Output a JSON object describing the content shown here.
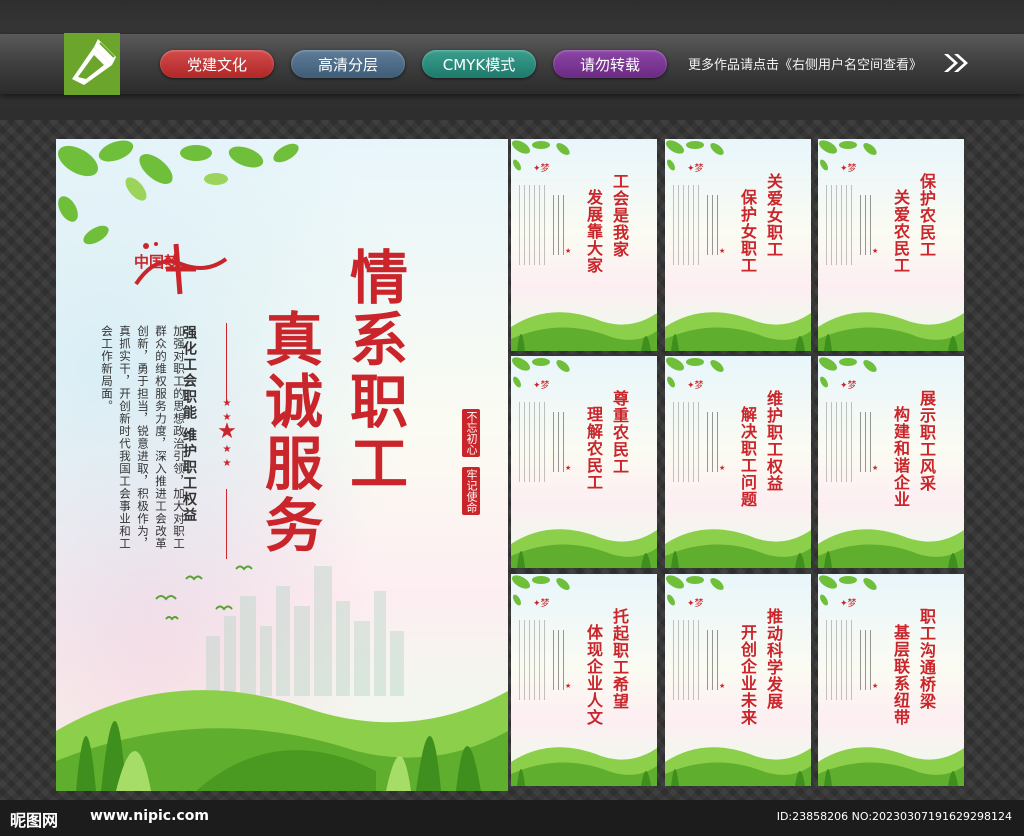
{
  "header": {
    "tags": [
      "党建文化",
      "高清分层",
      "CMYK模式",
      "请勿转载"
    ],
    "more_text": "更多作品请点击《右侧用户名空间查看》",
    "arrow_icon": "double-chevron-right-icon"
  },
  "main_board": {
    "logo_text": "中国梦",
    "title_line1": "情系职工",
    "title_line2": "真诚服务",
    "motto_a": "不忘初心",
    "motto_b": "牢记使命",
    "subtitle": "强化工会职能  维护职工权益",
    "body": "加强对职工的思想政治引领，加大对职工群众的维权服务力度，深入推进工会改革创新，勇于担当，锐意进取，积极作为，真抓实干，开创新时代我国工会事业和工会工作新局面。"
  },
  "boards": [
    {
      "line1": "工会是我家",
      "line2": "发展靠大家"
    },
    {
      "line1": "关爱女职工",
      "line2": "保护女职工"
    },
    {
      "line1": "保护农民工",
      "line2": "关爱农民工"
    },
    {
      "line1": "尊重农民工",
      "line2": "理解农民工"
    },
    {
      "line1": "维护职工权益",
      "line2": "解决职工问题"
    },
    {
      "line1": "展示职工风采",
      "line2": "构建和谐企业"
    },
    {
      "line1": "托起职工希望",
      "line2": "体现企业人文"
    },
    {
      "line1": "推动科学发展",
      "line2": "开创企业未来"
    },
    {
      "line1": "职工沟通桥梁",
      "line2": "基层联系纽带"
    }
  ],
  "footer": {
    "site_name": "昵图网",
    "site_url": "www.nipic.com",
    "id_text": "ID:23858206 NO:20230307191629298124"
  }
}
